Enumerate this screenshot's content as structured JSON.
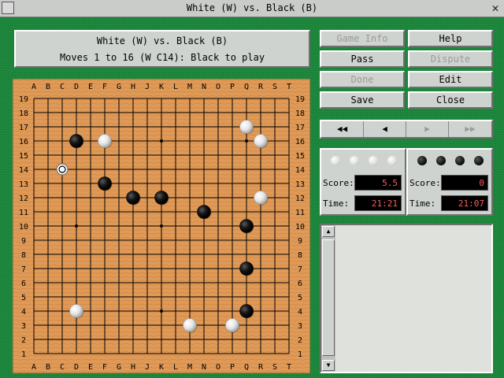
{
  "window": {
    "title": "White (W) vs. Black (B)",
    "close_glyph": "✕"
  },
  "info": {
    "line1": "White (W) vs. Black (B)",
    "line2": "Moves 1 to 16 (W C14): Black to play"
  },
  "buttons": {
    "game_info": "Game Info",
    "help": "Help",
    "pass": "Pass",
    "dispute": "Dispute",
    "done": "Done",
    "edit": "Edit",
    "save": "Save",
    "close": "Close"
  },
  "navigation": [
    {
      "icon": "first-icon",
      "glyph": "◀◀",
      "enabled": true
    },
    {
      "icon": "previous-icon",
      "glyph": "◀",
      "enabled": true
    },
    {
      "icon": "next-icon",
      "glyph": "▶",
      "enabled": false
    },
    {
      "icon": "last-icon",
      "glyph": "▶▶",
      "enabled": false
    }
  ],
  "white_player": {
    "score_label": "Score:",
    "score": "5.5",
    "time_label": "Time:",
    "time": "21:21",
    "captures": 4
  },
  "black_player": {
    "score_label": "Score:",
    "score": "0",
    "time_label": "Time:",
    "time": "21:07",
    "captures": 4
  },
  "board": {
    "size": 19,
    "columns": [
      "A",
      "B",
      "C",
      "D",
      "E",
      "F",
      "G",
      "H",
      "J",
      "K",
      "L",
      "M",
      "N",
      "O",
      "P",
      "Q",
      "R",
      "S",
      "T"
    ],
    "rows": [
      "19",
      "18",
      "17",
      "16",
      "15",
      "14",
      "13",
      "12",
      "11",
      "10",
      "9",
      "8",
      "7",
      "6",
      "5",
      "4",
      "3",
      "2",
      "1"
    ],
    "star_points": [
      [
        3,
        3
      ],
      [
        3,
        9
      ],
      [
        3,
        15
      ],
      [
        9,
        3
      ],
      [
        9,
        9
      ],
      [
        9,
        15
      ],
      [
        15,
        3
      ],
      [
        15,
        9
      ],
      [
        15,
        15
      ]
    ],
    "stones": [
      {
        "color": "white",
        "col": 15,
        "row": 17
      },
      {
        "color": "white",
        "col": 5,
        "row": 16
      },
      {
        "color": "white",
        "col": 16,
        "row": 16
      },
      {
        "color": "white",
        "col": 2,
        "row": 14,
        "last": true
      },
      {
        "color": "white",
        "col": 16,
        "row": 12
      },
      {
        "color": "white",
        "col": 3,
        "row": 4
      },
      {
        "color": "white",
        "col": 11,
        "row": 3
      },
      {
        "color": "white",
        "col": 14,
        "row": 3
      },
      {
        "color": "black",
        "col": 3,
        "row": 16
      },
      {
        "color": "black",
        "col": 5,
        "row": 13
      },
      {
        "color": "black",
        "col": 7,
        "row": 12
      },
      {
        "color": "black",
        "col": 9,
        "row": 12
      },
      {
        "color": "black",
        "col": 12,
        "row": 11
      },
      {
        "color": "black",
        "col": 15,
        "row": 10
      },
      {
        "color": "black",
        "col": 15,
        "row": 7
      },
      {
        "color": "black",
        "col": 15,
        "row": 4
      }
    ]
  },
  "colors": {
    "felt": "#1f8b3f",
    "board": "#e09a58",
    "panel": "#cfd3cf",
    "timer_text": "#ff5a5a"
  }
}
